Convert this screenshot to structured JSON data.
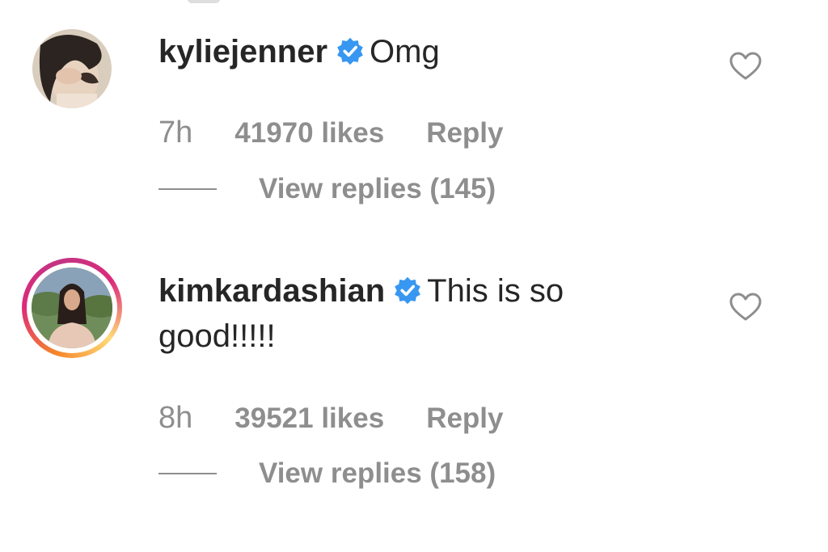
{
  "comments": [
    {
      "username": "kyliejenner",
      "verified": true,
      "text": "Omg",
      "time": "7h",
      "likes": "41970 likes",
      "reply_label": "Reply",
      "view_replies": "View replies (145)",
      "has_story": false
    },
    {
      "username": "kimkardashian",
      "verified": true,
      "text": "This is so good!!!!!",
      "time": "8h",
      "likes": "39521 likes",
      "reply_label": "Reply",
      "view_replies": "View replies (158)",
      "has_story": true
    }
  ],
  "icons": {
    "verified": "verified-badge-icon",
    "like": "heart-outline-icon"
  },
  "colors": {
    "verified_blue": "#3897f0",
    "secondary_text": "#8e8e8e",
    "primary_text": "#262626"
  }
}
